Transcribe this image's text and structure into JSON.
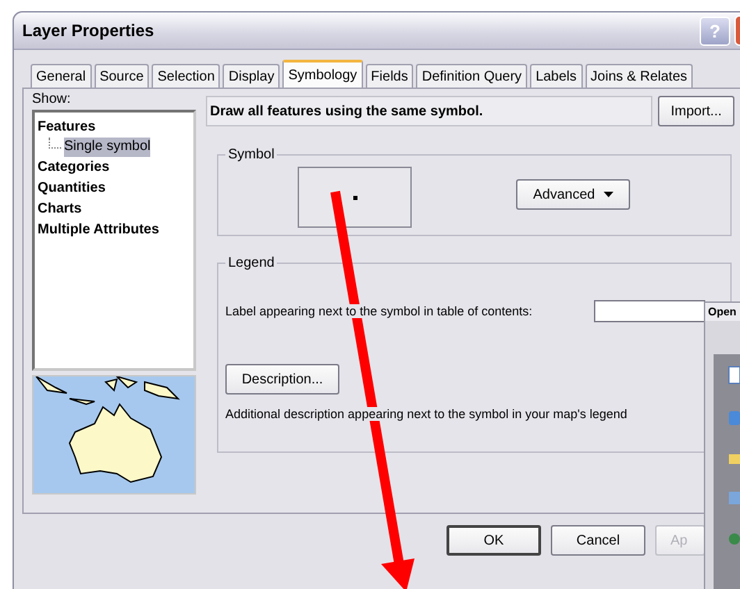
{
  "window": {
    "title": "Layer Properties",
    "help_button": "?"
  },
  "tabs": [
    {
      "label": "General",
      "selected": false
    },
    {
      "label": "Source",
      "selected": false
    },
    {
      "label": "Selection",
      "selected": false
    },
    {
      "label": "Display",
      "selected": false
    },
    {
      "label": "Symbology",
      "selected": true
    },
    {
      "label": "Fields",
      "selected": false
    },
    {
      "label": "Definition Query",
      "selected": false
    },
    {
      "label": "Labels",
      "selected": false
    },
    {
      "label": "Joins & Relates",
      "selected": false
    }
  ],
  "show": {
    "label": "Show:",
    "items": [
      {
        "label": "Features",
        "selected": false,
        "children": [
          {
            "label": "Single symbol",
            "selected": true
          }
        ]
      },
      {
        "label": "Categories",
        "selected": false
      },
      {
        "label": "Quantities",
        "selected": false
      },
      {
        "label": "Charts",
        "selected": false
      },
      {
        "label": "Multiple Attributes",
        "selected": false
      }
    ]
  },
  "header": {
    "text": "Draw all features using the same symbol.",
    "import_button": "Import..."
  },
  "symbol_group": {
    "title": "Symbol",
    "advanced_button": "Advanced"
  },
  "legend_group": {
    "title": "Legend",
    "label_prompt": "Label appearing next to the symbol in table of contents:",
    "description_button": "Description...",
    "description_note": "Additional description appearing next to the symbol in your map's legend"
  },
  "buttons": [
    {
      "label": "OK",
      "disabled": false
    },
    {
      "label": "Cancel",
      "disabled": false
    },
    {
      "label": "Ap",
      "disabled": true
    }
  ],
  "open_window": {
    "title": "Open"
  }
}
